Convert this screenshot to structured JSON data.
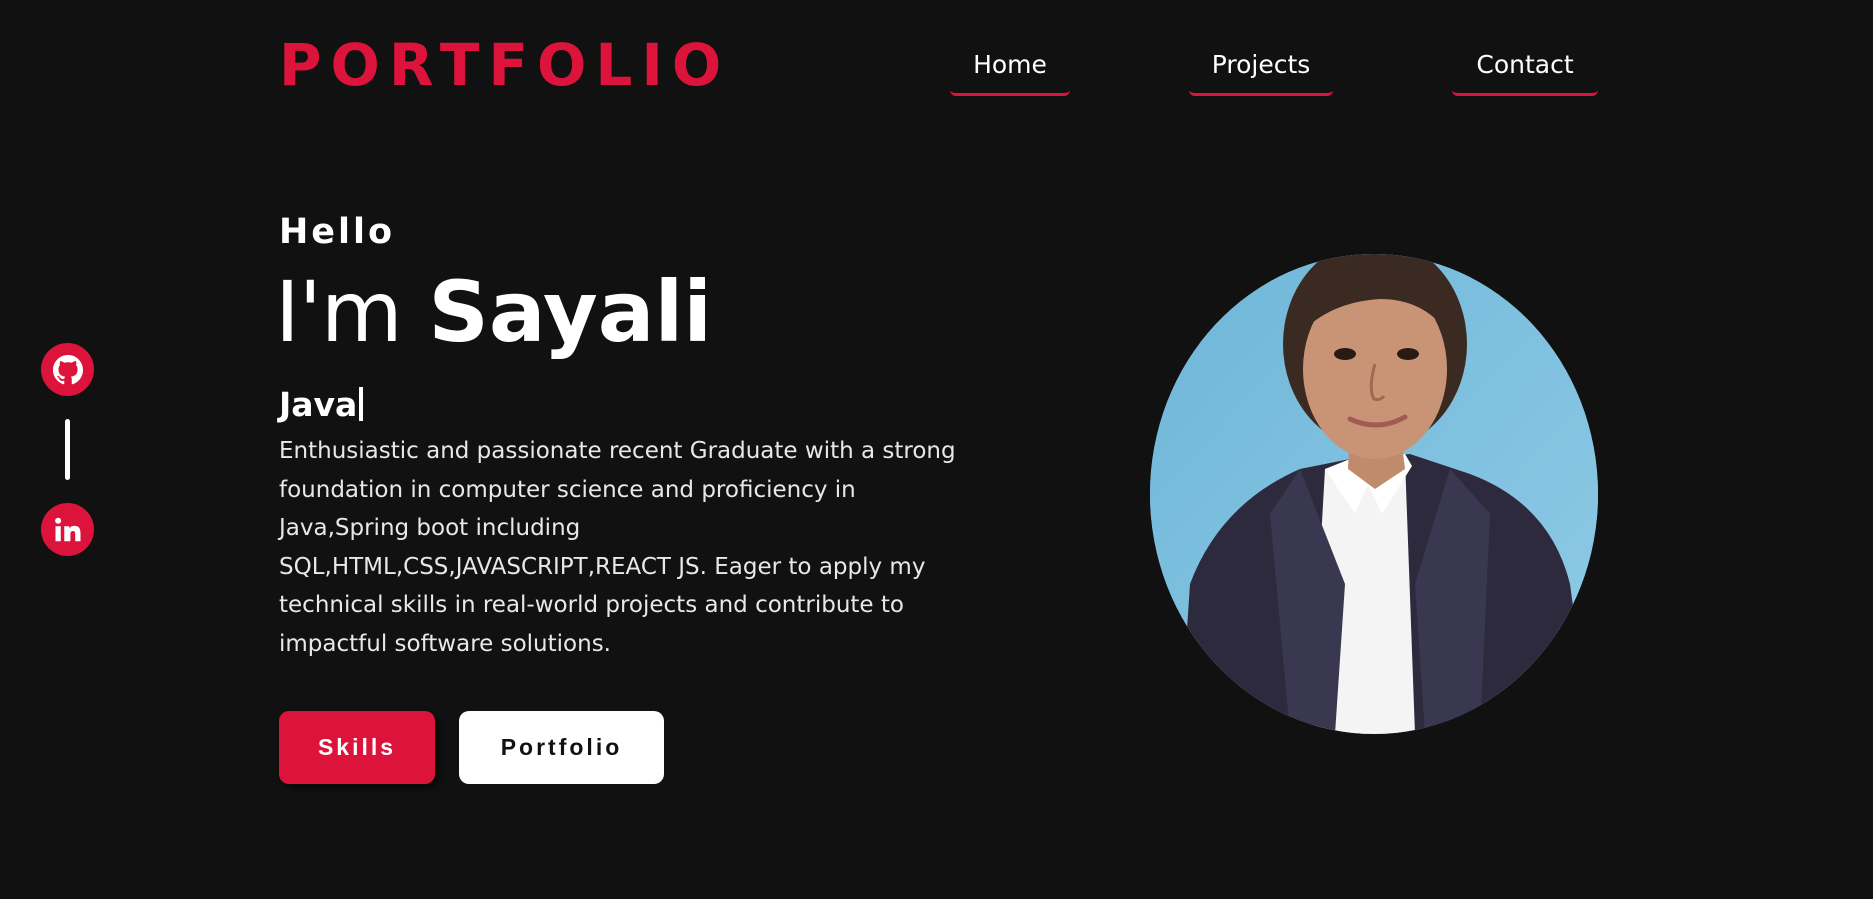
{
  "header": {
    "logo": "PORTFOLIO",
    "nav": [
      {
        "label": "Home"
      },
      {
        "label": "Projects"
      },
      {
        "label": "Contact"
      }
    ]
  },
  "social": {
    "items": [
      {
        "icon": "github-icon"
      },
      {
        "icon": "linkedin-icon"
      }
    ]
  },
  "hero": {
    "greeting": "Hello",
    "intro_prefix": "I'm",
    "name": "Sayali",
    "typed_text": "Java",
    "description": "Enthusiastic and passionate recent Graduate with a strong foundation in computer science and proficiency in Java,Spring boot including SQL,HTML,CSS,JAVASCRIPT,REACT JS. Eager to apply my technical skills in real-world projects and contribute to impactful software solutions.",
    "buttons": {
      "primary": "Skills",
      "secondary": "Portfolio"
    }
  },
  "colors": {
    "background": "#111111",
    "accent": "#dc143c",
    "text": "#ffffff"
  }
}
